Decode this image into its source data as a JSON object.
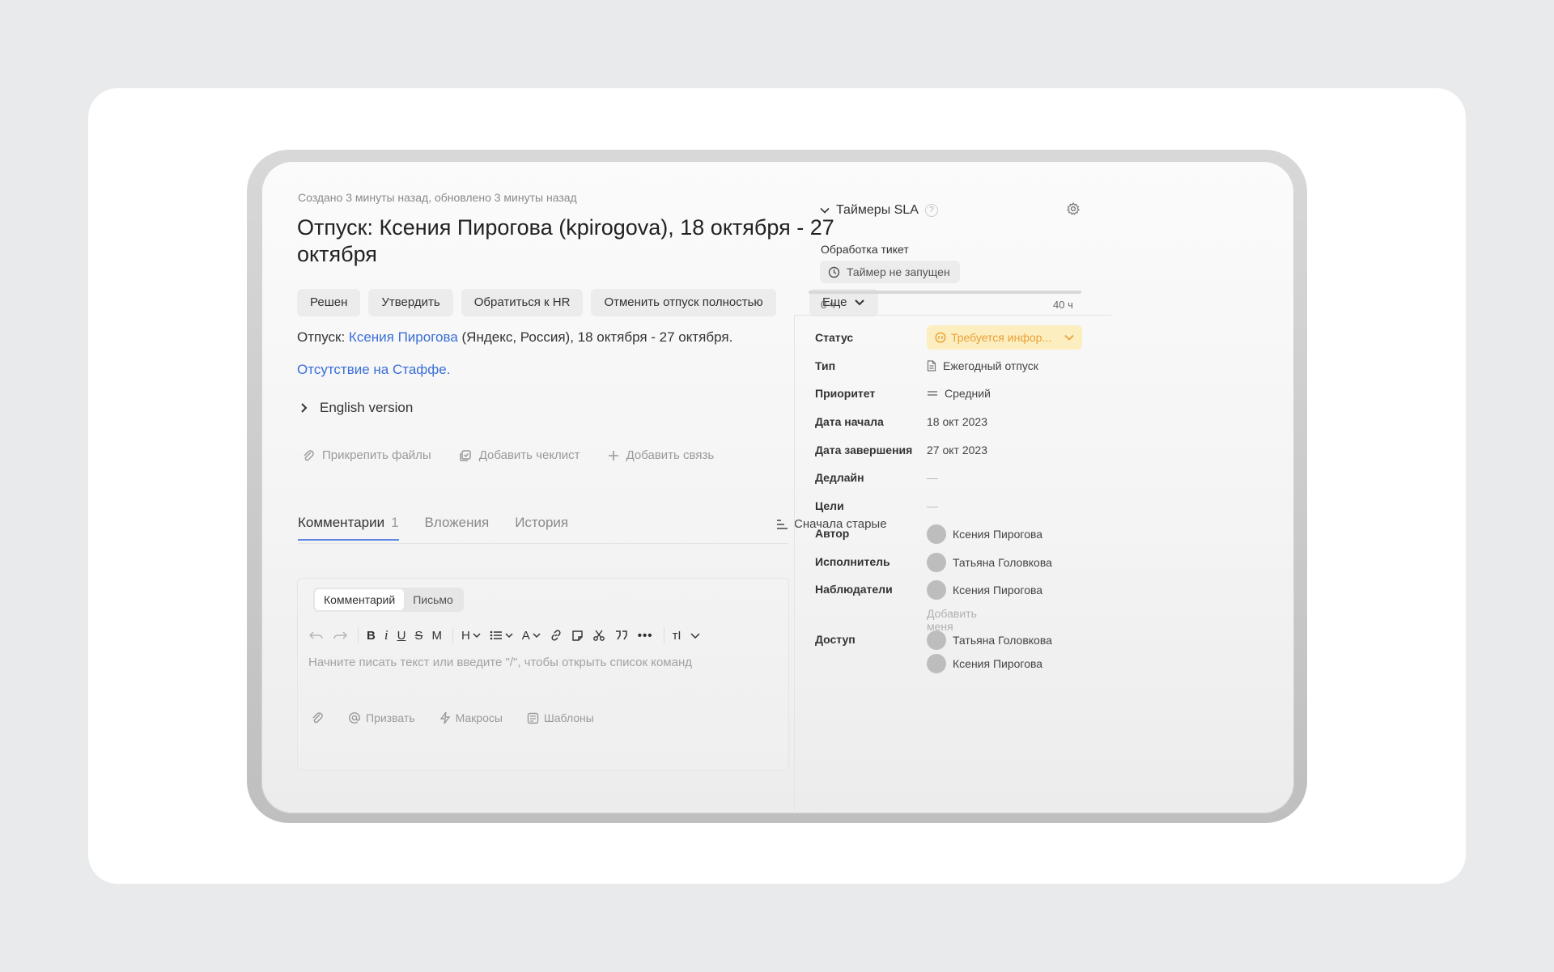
{
  "meta": "Создано 3 минуты назад, обновлено 3 минуты назад",
  "title": "Отпуск: Ксения Пирогова (kpirogova), 18 октября - 27 октября",
  "actions": [
    "Решен",
    "Утвердить",
    "Обратиться к HR",
    "Отменить отпуск полностью"
  ],
  "more_label": "Еще",
  "description": {
    "prefix": "Отпуск: ",
    "person_link": "Ксения Пирогова",
    "suffix": " (Яндекс, Россия), 18 октября - 27 октября."
  },
  "staff_link": "Отсутствие на Стаффе.",
  "english_version": "English version",
  "attach_row": {
    "attach": "Прикрепить файлы",
    "checklist": "Добавить чеклист",
    "relation": "Добавить связь"
  },
  "tabs": {
    "comments": "Комментарии",
    "comments_count": "1",
    "attachments": "Вложения",
    "history": "История"
  },
  "sort_label": "Сначала старые",
  "editor": {
    "mode_comment": "Комментарий",
    "mode_letter": "Письмо",
    "placeholder": "Начните писать текст или введите \"/\", чтобы открыть список команд",
    "toolbar": {
      "bold": "B",
      "italic": "i",
      "underline": "U",
      "strike": "S",
      "mono": "M",
      "heading": "H",
      "color": "A",
      "more": "•••",
      "text_size": "тI"
    },
    "footer": {
      "summon": "Призвать",
      "macros": "Макросы",
      "templates": "Шаблоны"
    }
  },
  "sla": {
    "header": "Таймеры SLA",
    "help": "?",
    "subheader": "Обработка тикет",
    "timer_status": "Таймер не запущен",
    "progress_fraction": 0,
    "range_start": "0 ч",
    "range_end": "40 ч"
  },
  "properties": {
    "status": {
      "label": "Статус",
      "value": "Требуется инфор..."
    },
    "type": {
      "label": "Тип",
      "value": "Ежегодный отпуск"
    },
    "priority": {
      "label": "Приоритет",
      "value": "Средний"
    },
    "start_date": {
      "label": "Дата начала",
      "value": "18 окт 2023"
    },
    "end_date": {
      "label": "Дата завершения",
      "value": "27 окт 2023"
    },
    "deadline": {
      "label": "Дедлайн",
      "value": "—"
    },
    "goals": {
      "label": "Цели",
      "value": "—"
    },
    "author": {
      "label": "Автор",
      "value": "Ксения Пирогова"
    },
    "assignee": {
      "label": "Исполнитель",
      "value": "Татьяна Головкова"
    },
    "watchers": {
      "label": "Наблюдатели",
      "value": "Ксения Пирогова",
      "add_me": "Добавить меня"
    },
    "access": {
      "label": "Доступ",
      "values": [
        "Татьяна Головкова",
        "Ксения Пирогова"
      ]
    }
  },
  "colors": {
    "link": "#3a6fd8",
    "status_bg": "#fdeec0",
    "status_text": "#e8a033"
  }
}
